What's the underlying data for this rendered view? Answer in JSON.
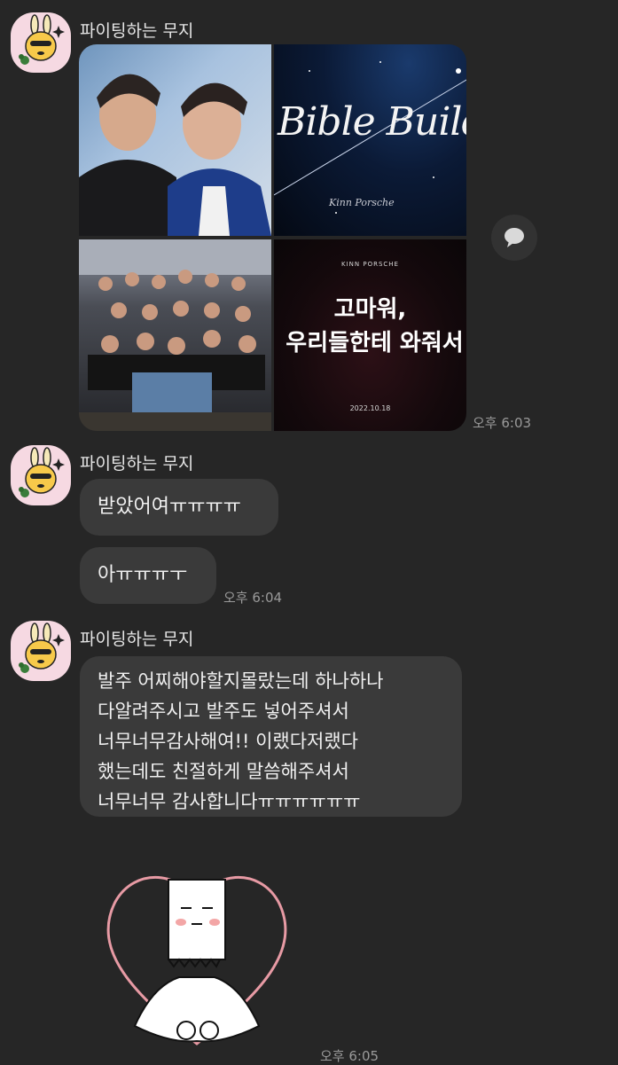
{
  "messages": {
    "group1": {
      "sender": "파이팅하는 무지",
      "photos": {
        "photo2_title": "Bible Build",
        "photo2_subtitle": "Kinn Porsche",
        "photo4_brand": "KINN PORSCHE",
        "photo4_line1": "고마워,",
        "photo4_line2": "우리들한테 와줘서",
        "photo4_date": "2022.10.18"
      },
      "time": "오후 6:03"
    },
    "group2": {
      "sender": "파이팅하는 무지",
      "bubble1": "받았어여ㅠㅠㅠㅠ",
      "bubble2": "아ㅠㅠㅠㅜ",
      "time": "오후 6:04"
    },
    "group3": {
      "sender": "파이팅하는 무지",
      "lines": [
        "발주 어찌해야할지몰랐는데 하나하나",
        "다알려주시고 발주도 넣어주셔서",
        "너무너무감사해여!! 이랬다저랬다",
        "했는데도 친절하게 말씀해주셔서",
        "너무너무 감사합니다ㅠㅠㅠㅠㅠㅠ"
      ],
      "time": "오후 6:05"
    }
  },
  "icons": {
    "avatar": "rabbit-character-icon",
    "share": "speech-bubble-icon",
    "sticker": "heart-character-sticker"
  },
  "colors": {
    "background": "#262626",
    "bubble": "#3a3a3a",
    "avatar_bg": "#f6d9e2",
    "heart": "#e79aa4"
  }
}
